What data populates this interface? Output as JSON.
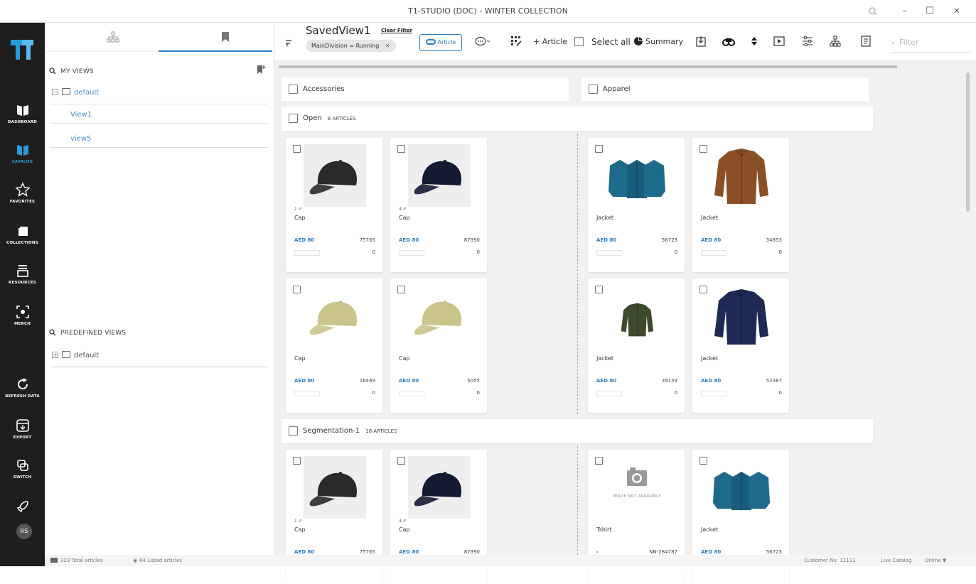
{
  "window": {
    "title": "T1-STUDIO (DOC) - WINTER COLLECTION",
    "zoom_icon": "search-icon",
    "min": "–",
    "max": "☐",
    "close": "✕"
  },
  "nav": [
    {
      "label": "DASHBOARD",
      "icon": "book-icon"
    },
    {
      "label": "CATALOG",
      "icon": "book-open-icon",
      "active": true
    },
    {
      "label": "FAVORITES",
      "icon": "star-icon"
    },
    {
      "label": "COLLECTIONS",
      "icon": "folder-icon"
    },
    {
      "label": "RESOURCES",
      "icon": "stack-icon"
    },
    {
      "label": "MERCH",
      "icon": "merch-icon"
    },
    {
      "label": "REFRESH DATA",
      "icon": "refresh-icon"
    },
    {
      "label": "EXPORT",
      "icon": "export-icon"
    },
    {
      "label": "SWITCH",
      "icon": "switch-icon"
    }
  ],
  "user": {
    "initials": "RS"
  },
  "left": {
    "my_views": "MY VIEWS",
    "my_views_tree": {
      "root": "default",
      "items": [
        "View1",
        "view5"
      ]
    },
    "predefined_views": "PREDEFINED VIEWS",
    "predefined_tree": {
      "root": "default"
    }
  },
  "toolbar": {
    "view_name": "SavedView1",
    "clear_filter": "Clear Filter",
    "chip": "MainDivision = Running",
    "chip_close": "✕",
    "article_toggle": "Article",
    "add_article": "+ Article",
    "select_all": "Select all",
    "summary": "Summary",
    "filter_placeholder": "Filter"
  },
  "categories": {
    "left": "Accessories",
    "right": "Apparel"
  },
  "groups": [
    {
      "name": "Open",
      "count": "8 ARTICLES"
    },
    {
      "name": "Segmentation-1",
      "count": "18 ARTICLES"
    }
  ],
  "cards_open": [
    {
      "num": "1 ✐",
      "name": "Cap",
      "price": "AED 80",
      "code": "75765",
      "qty": "0",
      "img": "cap-black"
    },
    {
      "num": "4 ✐",
      "name": "Cap",
      "price": "AED 80",
      "code": "87990",
      "qty": "0",
      "img": "cap-navy"
    },
    {
      "num": "",
      "name": "Jacket",
      "price": "AED 80",
      "code": "56723",
      "qty": "0",
      "img": "jacket-teal"
    },
    {
      "num": "",
      "name": "Jacket",
      "price": "AED 80",
      "code": "34853",
      "qty": "0",
      "img": "jacket-brown"
    },
    {
      "num": "",
      "name": "Cap",
      "price": "AED 80",
      "code": "16469",
      "qty": "0",
      "img": "cap-khaki"
    },
    {
      "num": "",
      "name": "Cap",
      "price": "AED 80",
      "code": "5055",
      "qty": "0",
      "img": "cap-khaki"
    },
    {
      "num": "",
      "name": "Jacket",
      "price": "AED 80",
      "code": "39159",
      "qty": "0",
      "img": "jacket-green"
    },
    {
      "num": "",
      "name": "Jacket",
      "price": "AED 80",
      "code": "52387",
      "qty": "0",
      "img": "jacket-navy"
    }
  ],
  "cards_seg": [
    {
      "num": "1 ✐",
      "name": "Cap",
      "price": "AED 80",
      "code": "75765",
      "img": "cap-black"
    },
    {
      "num": "4 ✐",
      "name": "Cap",
      "price": "AED 80",
      "code": "87990",
      "img": "cap-navy"
    },
    {
      "num": "",
      "name": "Tshirt",
      "price": "-",
      "code": "NN-284787",
      "img": "no-image",
      "no_image_text": "IMAGE NOT AVAILABLE"
    },
    {
      "num": "",
      "name": "Jacket",
      "price": "AED 80",
      "code": "56723",
      "img": "jacket-teal"
    }
  ],
  "status": {
    "total": "323 Total articles",
    "listed": "64 Listed articles",
    "customer": "Customer No: 11111",
    "catalog": "Live Catalog",
    "online": "Online"
  },
  "colors": {
    "accent": "#2d7fc1",
    "rail": "#1e1e1e",
    "link": "#4a8fd0"
  }
}
